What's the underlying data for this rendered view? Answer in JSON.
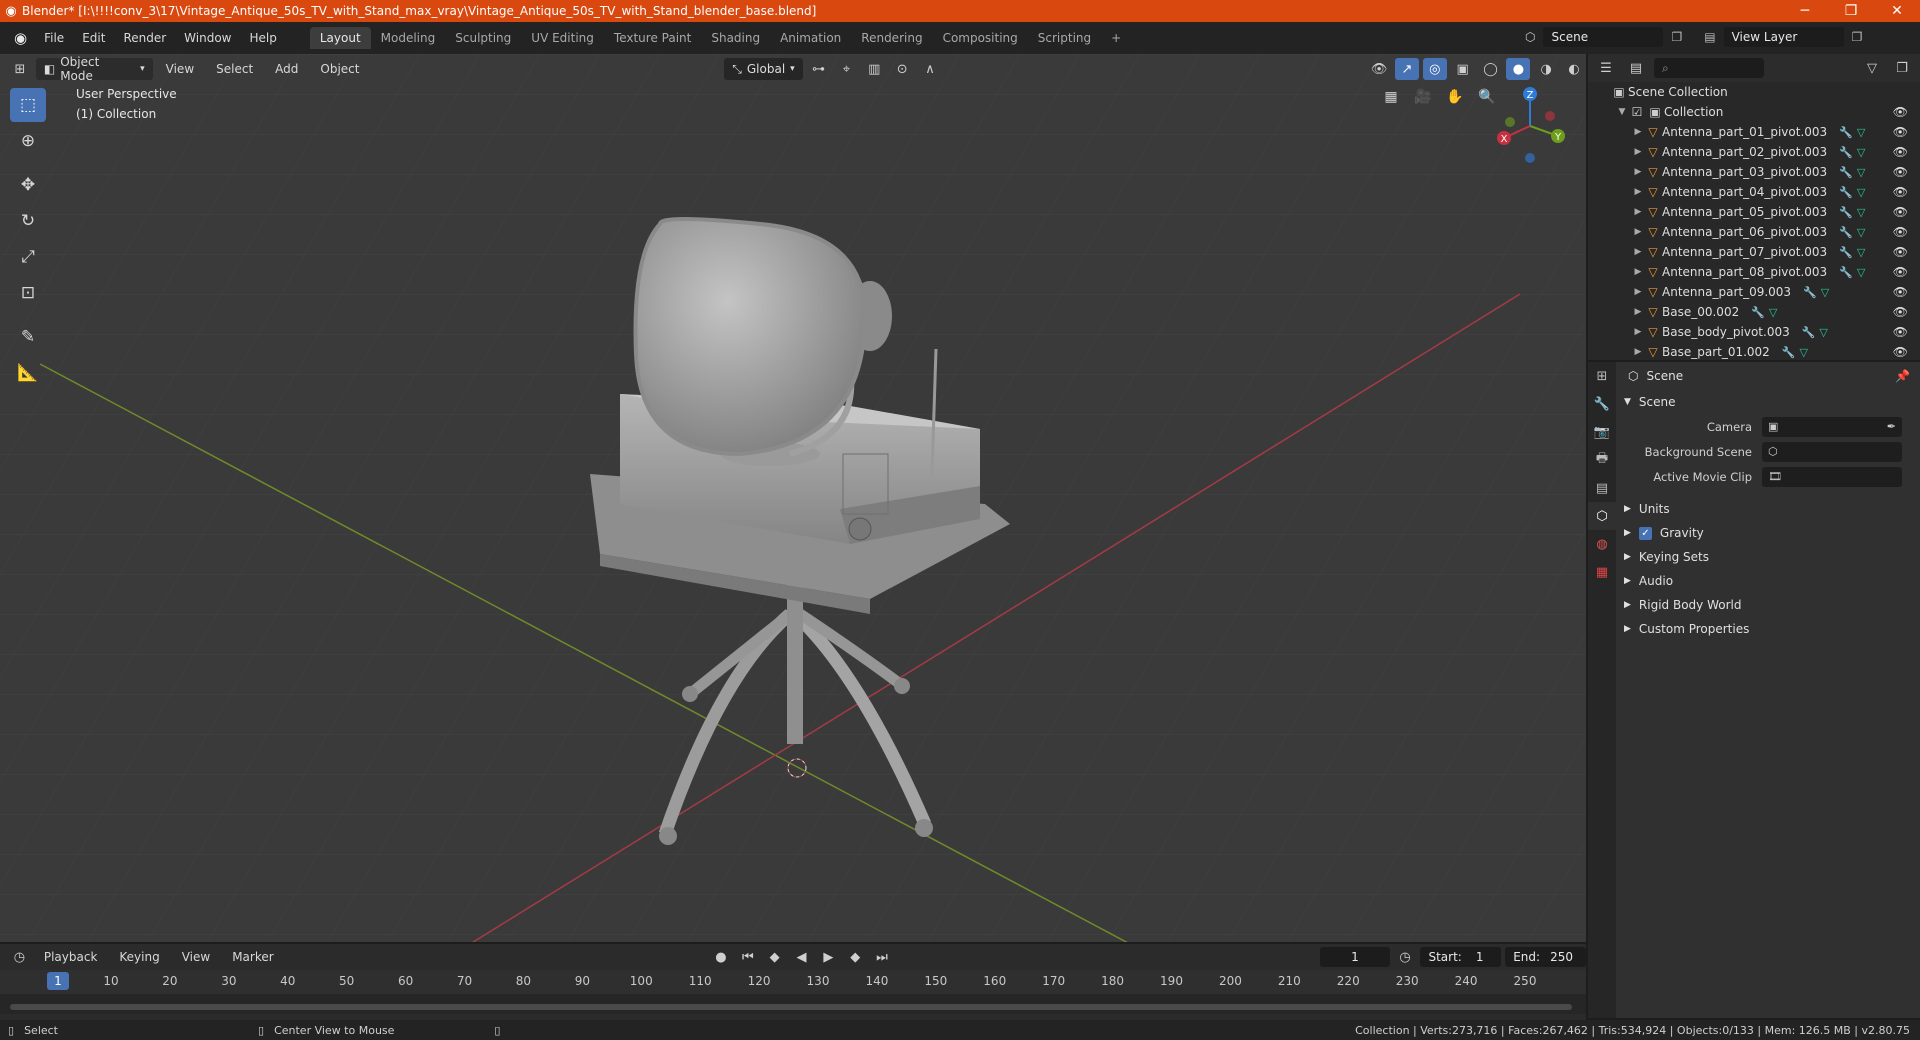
{
  "window": {
    "title": "Blender* [I:\\!!!!conv_3\\17\\Vintage_Antique_50s_TV_with_Stand_max_vray\\Vintage_Antique_50s_TV_with_Stand_blender_base.blend]",
    "minimize": "─",
    "maximize": "❐",
    "close": "✕"
  },
  "menu": {
    "items": [
      "File",
      "Edit",
      "Render",
      "Window",
      "Help"
    ],
    "workspaces": [
      "Layout",
      "Modeling",
      "Sculpting",
      "UV Editing",
      "Texture Paint",
      "Shading",
      "Animation",
      "Rendering",
      "Compositing",
      "Scripting"
    ],
    "active_workspace": "Layout",
    "add_workspace": "+",
    "scene": "Scene",
    "view_layer": "View Layer"
  },
  "viewport": {
    "mode": "Object Mode",
    "menus": [
      "View",
      "Select",
      "Add",
      "Object"
    ],
    "orientation": "Global",
    "perspective": "User Perspective",
    "collection_info": "(1) Collection",
    "axis": {
      "x": "X",
      "y": "Y",
      "z": "Z"
    }
  },
  "outliner": {
    "root": "Scene Collection",
    "collection": "Collection",
    "items": [
      "Antenna_part_01_pivot.003",
      "Antenna_part_02_pivot.003",
      "Antenna_part_03_pivot.003",
      "Antenna_part_04_pivot.003",
      "Antenna_part_05_pivot.003",
      "Antenna_part_06_pivot.003",
      "Antenna_part_07_pivot.003",
      "Antenna_part_08_pivot.003",
      "Antenna_part_09.003",
      "Base_00.002",
      "Base_body_pivot.003",
      "Base_part_01.002"
    ]
  },
  "properties": {
    "context": "Scene",
    "panel": "Scene",
    "camera_label": "Camera",
    "background_scene_label": "Background Scene",
    "active_movie_clip_label": "Active Movie Clip",
    "sections": [
      "Units",
      "Gravity",
      "Keying Sets",
      "Audio",
      "Rigid Body World",
      "Custom Properties"
    ]
  },
  "timeline": {
    "menus": [
      "Playback",
      "Keying",
      "View",
      "Marker"
    ],
    "current_frame": "1",
    "start_label": "Start:",
    "start": "1",
    "end_label": "End:",
    "end": "250",
    "ticks": [
      "1",
      "10",
      "20",
      "30",
      "40",
      "50",
      "60",
      "70",
      "80",
      "90",
      "100",
      "110",
      "120",
      "130",
      "140",
      "150",
      "160",
      "170",
      "180",
      "190",
      "200",
      "210",
      "220",
      "230",
      "240",
      "250"
    ]
  },
  "status": {
    "select": "Select",
    "center_view": "Center View to Mouse",
    "stats": "Collection | Verts:273,716 | Faces:267,462 | Tris:534,924 | Objects:0/133 | Mem: 126.5 MB | v2.80.75"
  },
  "colors": {
    "title_bar": "#d9480f",
    "accent": "#4772b3",
    "x_axis": "#c7313f",
    "y_axis": "#6e9e1c",
    "z_axis": "#2f7bd8",
    "mesh_icon": "#e69a3c",
    "modifier_icon": "#6aa6e8",
    "data_icon": "#25c49b"
  }
}
